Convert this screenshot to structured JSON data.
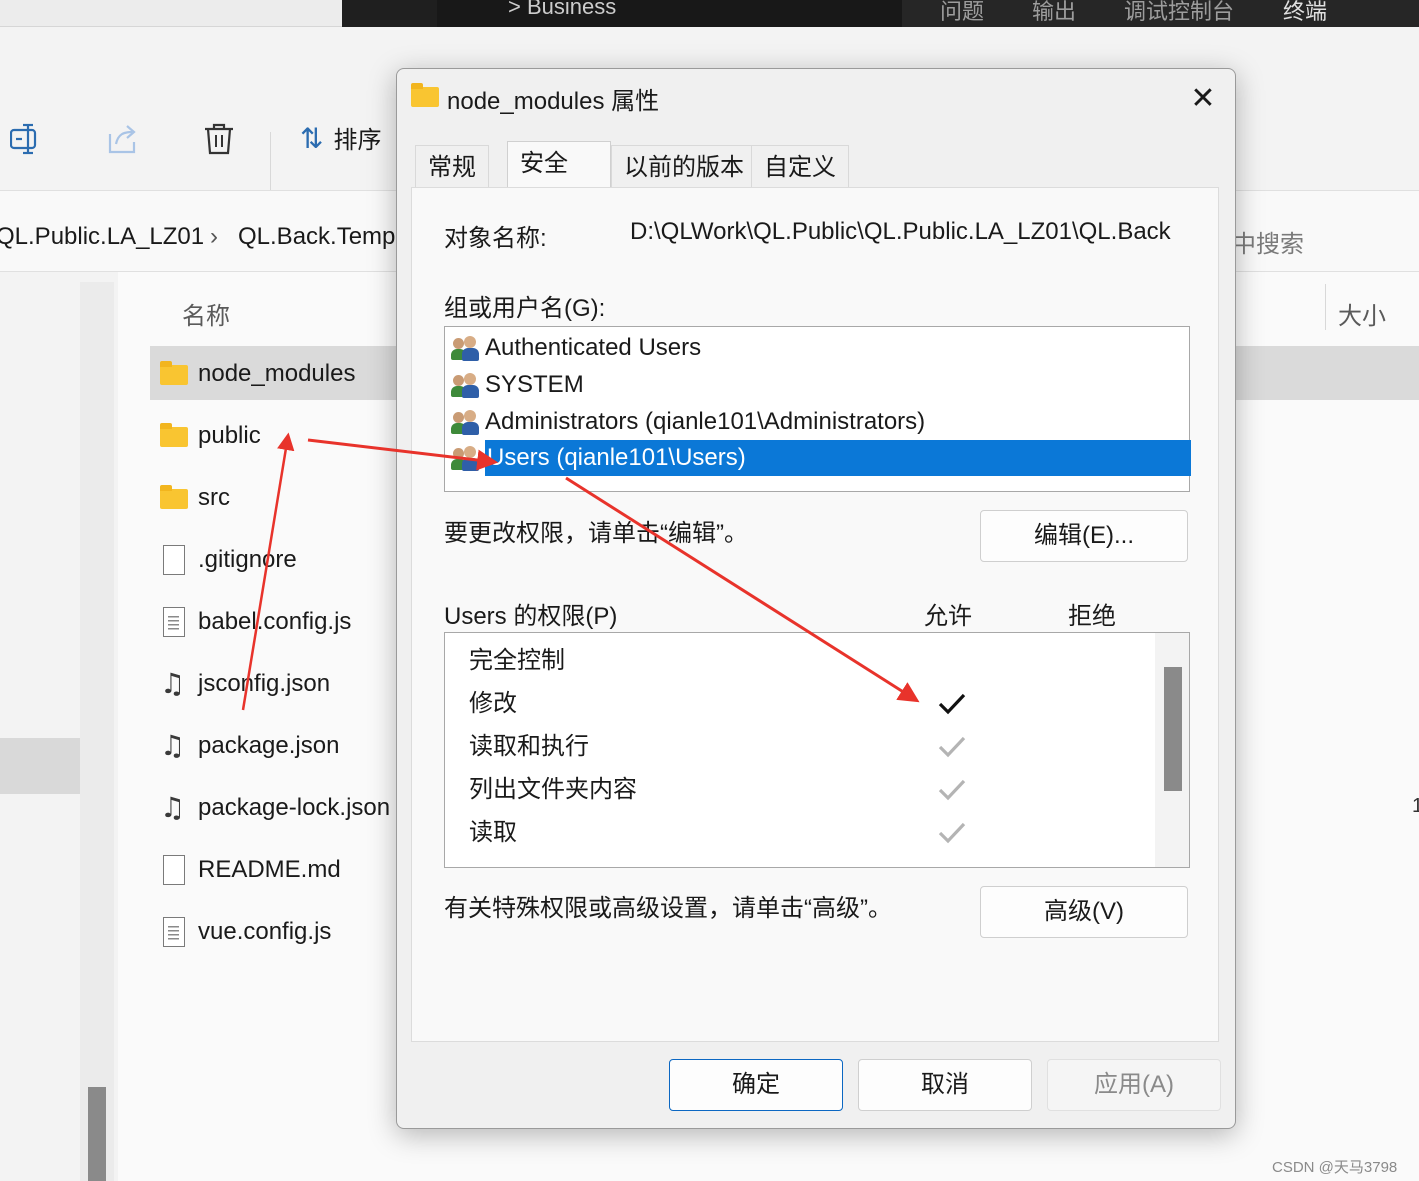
{
  "vscode": {
    "breadcrumb": "> Business",
    "panel_tabs": [
      "问题",
      "输出",
      "调试控制台",
      "终端"
    ]
  },
  "explorer": {
    "toolbar": {
      "icons": [
        "rename-icon",
        "share-icon",
        "delete-icon"
      ],
      "sort_label": "排序"
    },
    "breadcrumb": [
      "QL.Public.LA_LZ01",
      "QL.Back.Temp"
    ],
    "search_placeholder": "中搜索",
    "column_name": "名称",
    "column_size": "大小",
    "files": [
      {
        "name": "node_modules",
        "icon": "folder-icon"
      },
      {
        "name": "public",
        "icon": "folder-icon"
      },
      {
        "name": "src",
        "icon": "folder-icon"
      },
      {
        "name": ".gitignore",
        "icon": "file-icon"
      },
      {
        "name": "babel.config.js",
        "icon": "text-file-icon"
      },
      {
        "name": "jsconfig.json",
        "icon": "json-file-icon"
      },
      {
        "name": "package.json",
        "icon": "json-file-icon"
      },
      {
        "name": "package-lock.json",
        "icon": "json-file-icon"
      },
      {
        "name": "README.md",
        "icon": "file-icon"
      },
      {
        "name": "vue.config.js",
        "icon": "text-file-icon"
      }
    ],
    "selected_file": "node_modules"
  },
  "dialog": {
    "title": "node_modules 属性",
    "tabs": [
      "常规",
      "安全",
      "以前的版本",
      "自定义"
    ],
    "active_tab": "安全",
    "object_name_label": "对象名称:",
    "object_name_value": "D:\\QLWork\\QL.Public\\QL.Public.LA_LZ01\\QL.Back",
    "groups_label": "组或用户名(G):",
    "groups": [
      "Authenticated Users",
      "SYSTEM",
      "Administrators (qianle101\\Administrators)",
      "Users (qianle101\\Users)"
    ],
    "selected_group": "Users (qianle101\\Users)",
    "edit_hint": "要更改权限，请单击“编辑”。",
    "edit_button": "编辑(E)...",
    "perm_label": "Users 的权限(P)",
    "allow_label": "允许",
    "deny_label": "拒绝",
    "permissions": [
      {
        "name": "完全控制",
        "allow": "none"
      },
      {
        "name": "修改",
        "allow": "checked"
      },
      {
        "name": "读取和执行",
        "allow": "inherited"
      },
      {
        "name": "列出文件夹内容",
        "allow": "inherited"
      },
      {
        "name": "读取",
        "allow": "inherited"
      }
    ],
    "advanced_hint": "有关特殊权限或高级设置，请单击“高级”。",
    "advanced_button": "高级(V)",
    "ok_button": "确定",
    "cancel_button": "取消",
    "apply_button": "应用(A)"
  },
  "colors": {
    "selection_blue": "#0b78d7",
    "arrow_red": "#e8332b",
    "folder_yellow": "#f9c531"
  },
  "watermark": "CSDN @天马3798"
}
